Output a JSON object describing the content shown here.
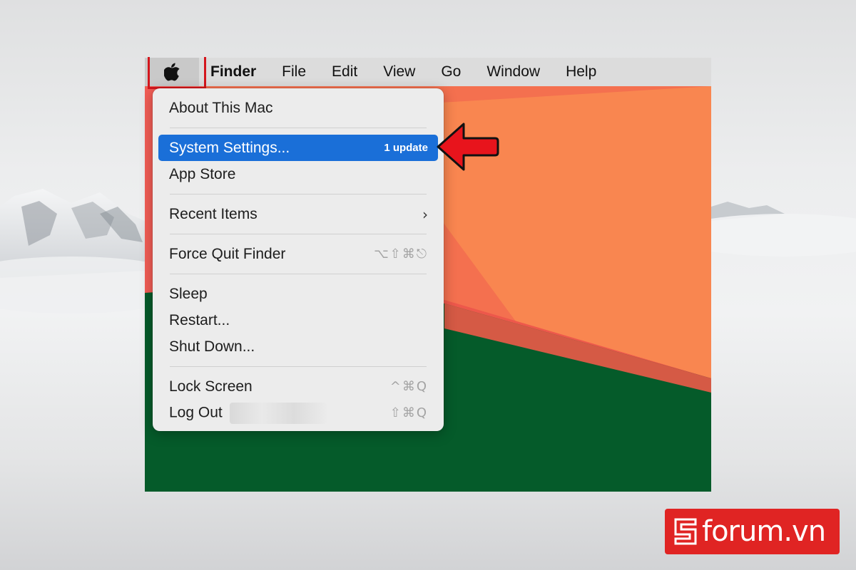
{
  "menubar": {
    "apple_icon": "apple-logo-icon",
    "items": [
      "Finder",
      "File",
      "Edit",
      "View",
      "Go",
      "Window",
      "Help"
    ]
  },
  "apple_menu": {
    "about": "About This Mac",
    "system_settings": "System Settings...",
    "system_settings_badge": "1 update",
    "app_store": "App Store",
    "recent_items": "Recent Items",
    "recent_items_icon": "chevron-right-icon",
    "force_quit": "Force Quit Finder",
    "force_quit_shortcut": "⌥⇧⌘⎋",
    "sleep": "Sleep",
    "restart": "Restart...",
    "shut_down": "Shut Down...",
    "lock_screen": "Lock Screen",
    "lock_screen_shortcut": "^⌘Q",
    "log_out": "Log Out",
    "log_out_shortcut": "⇧⌘Q"
  },
  "annotation": {
    "arrow_icon": "red-arrow-left-icon",
    "highlight_color": "#d4161d"
  },
  "watermark": {
    "text": "forum.vn",
    "brand_color": "#e02423"
  },
  "colors": {
    "selection": "#1a6fd8",
    "wallpaper_red": "#f25d55",
    "wallpaper_orange": "#f9854f",
    "wallpaper_green": "#055b2a"
  }
}
